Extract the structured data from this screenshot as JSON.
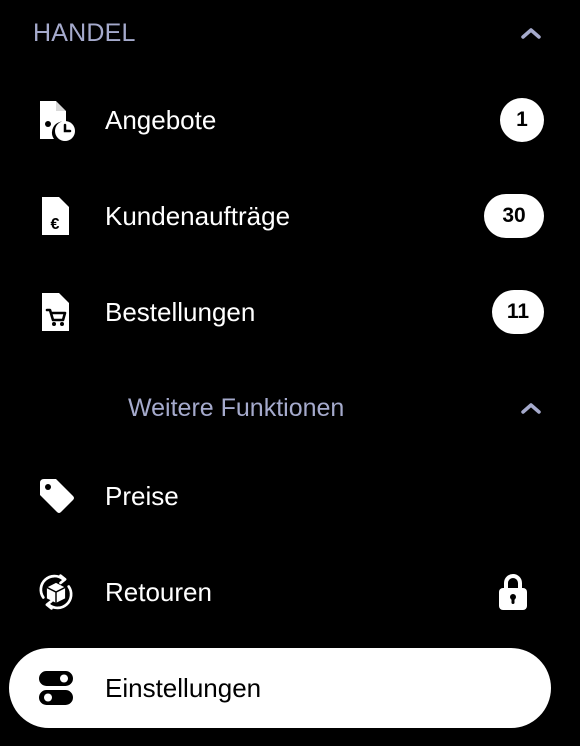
{
  "section": {
    "title": "HANDEL",
    "chevron_icon": "chevron-up-icon"
  },
  "items": [
    {
      "label": "Angebote",
      "icon": "document-clock-icon",
      "badge": "1"
    },
    {
      "label": "Kundenaufträge",
      "icon": "document-euro-icon",
      "badge": "30"
    },
    {
      "label": "Bestellungen",
      "icon": "document-cart-icon",
      "badge": "11"
    }
  ],
  "more": {
    "title": "Weitere Funktionen",
    "chevron_icon": "chevron-up-icon"
  },
  "more_items": [
    {
      "label": "Preise",
      "icon": "price-tag-icon"
    },
    {
      "label": "Retouren",
      "icon": "return-box-icon",
      "lock_icon": "lock-icon"
    }
  ],
  "settings": {
    "label": "Einstellungen",
    "icon": "settings-toggle-icon"
  },
  "colors": {
    "background": "#000000",
    "header_text": "#a5aacc",
    "text": "#ffffff",
    "active_background": "#ffffff",
    "active_text": "#000000"
  }
}
